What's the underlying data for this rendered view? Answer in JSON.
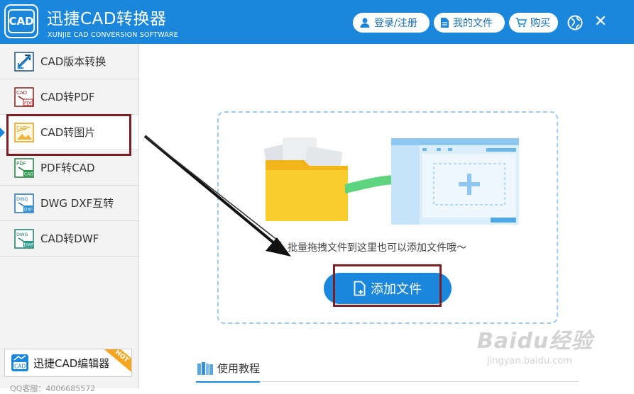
{
  "header": {
    "logo_text": "CAD",
    "title": "迅捷CAD转换器",
    "subtitle": "XUNJIE CAD CONVERSION SOFTWARE",
    "login_label": "登录/注册",
    "myfiles_label": "我的文件",
    "buy_label": "购买",
    "globe_icon": "globe-icon",
    "close_icon": "close-icon"
  },
  "sidebar": {
    "items": [
      {
        "label": "CAD版本转换",
        "icon": "cad-version-icon"
      },
      {
        "label": "CAD转PDF",
        "icon": "cad-to-pdf-icon"
      },
      {
        "label": "CAD转图片",
        "icon": "cad-to-image-icon"
      },
      {
        "label": "PDF转CAD",
        "icon": "pdf-to-cad-icon"
      },
      {
        "label": "DWG DXF互转",
        "icon": "dwg-dxf-icon"
      },
      {
        "label": "CAD转DWF",
        "icon": "cad-to-dwf-icon"
      }
    ],
    "active_index": 2,
    "editor_label": "迅捷CAD编辑器",
    "hot_badge": "HOT",
    "qq_text": "QQ客服：4006685572"
  },
  "main": {
    "drop_hint": "批量拖拽文件到这里也可以添加文件哦～",
    "add_button": "添加文件",
    "tutorial_label": "使用教程"
  },
  "watermark": {
    "main": "Baidu经验",
    "sub": "jingyan.baidu.com"
  },
  "colors": {
    "primary": "#1a86dc",
    "highlight": "#7b1f24",
    "folder": "#f7c31f",
    "arrow_green": "#5dd47d"
  }
}
